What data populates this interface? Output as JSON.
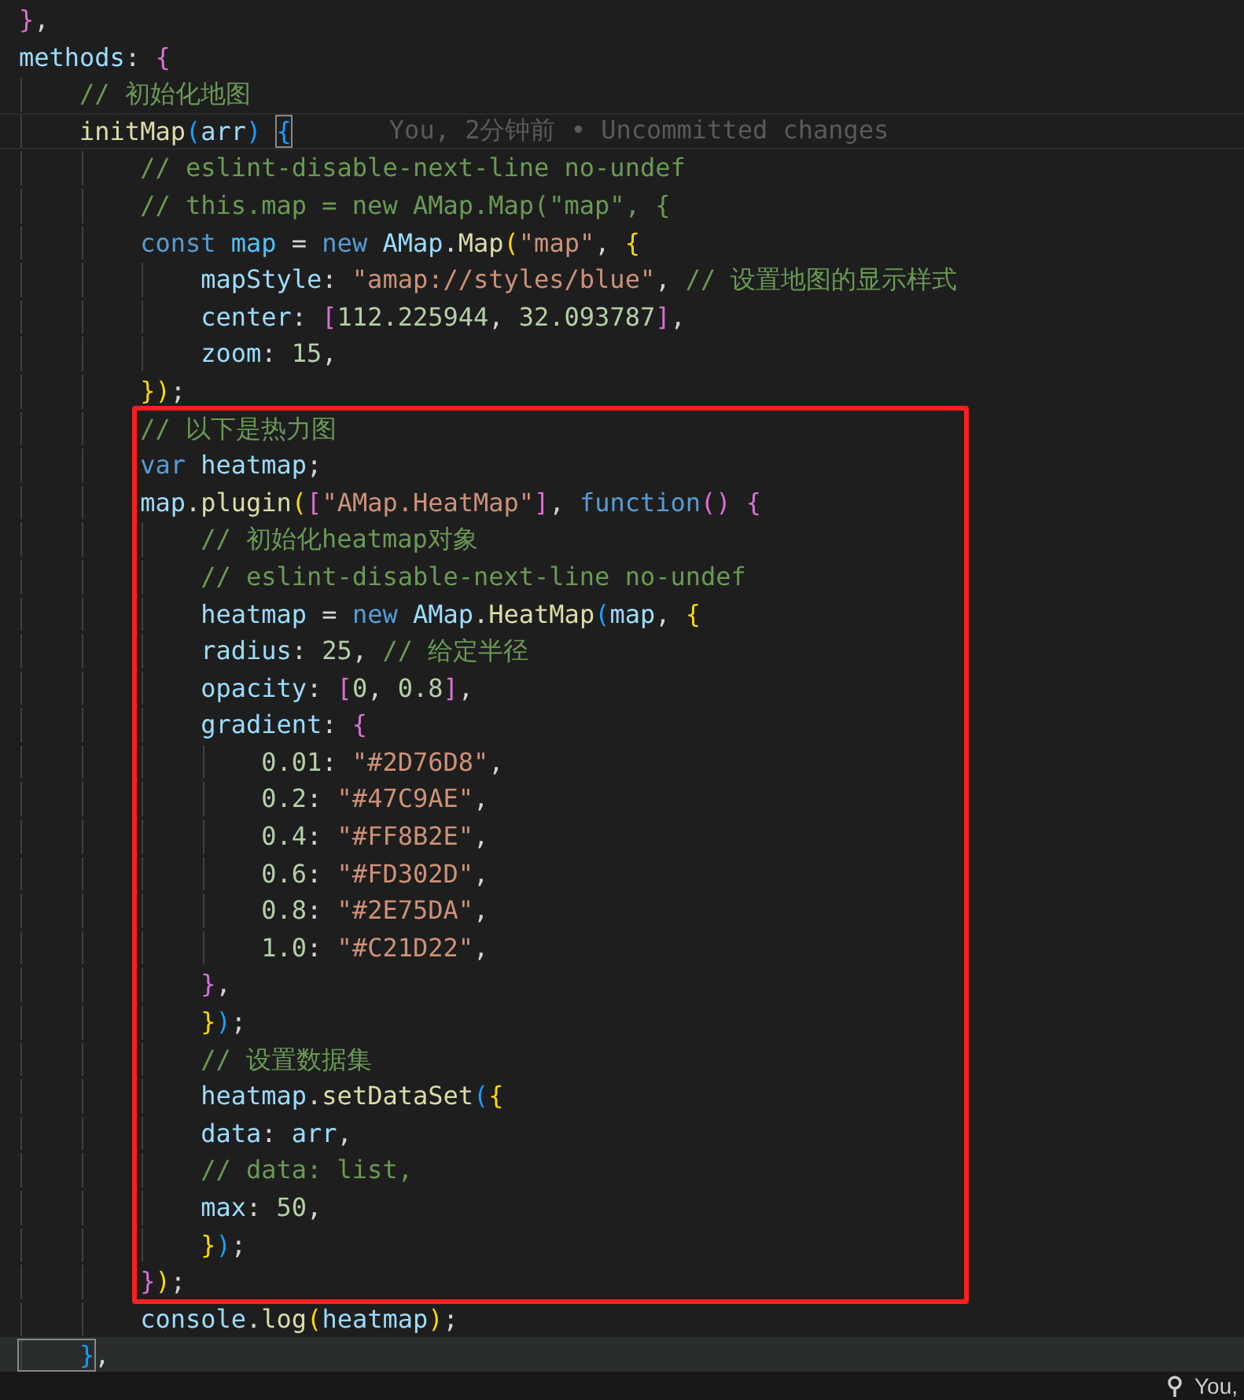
{
  "editor": {
    "lines_before": [
      {
        "tokens": [
          {
            "kind": "m",
            "text": "}"
          },
          {
            "kind": "p",
            "text": ","
          }
        ]
      },
      {
        "tokens": [
          {
            "kind": "v",
            "text": "methods"
          },
          {
            "kind": "p",
            "text": ": "
          },
          {
            "kind": "m",
            "text": "{"
          }
        ]
      },
      {
        "tokens": [
          {
            "kind": "c",
            "text": "    // 初始化地图"
          }
        ]
      },
      {
        "current": true,
        "tokens": [
          {
            "kind": "f",
            "text": "    initMap"
          },
          {
            "kind": "b",
            "text": "("
          },
          {
            "kind": "v",
            "text": "arr"
          },
          {
            "kind": "b",
            "text": ") "
          },
          {
            "kind": "b",
            "text": "{",
            "matched": true
          }
        ],
        "blame": "You, 2分钟前 • Uncommitted changes"
      },
      {
        "tokens": [
          {
            "kind": "c",
            "text": "        // eslint-disable-next-line no-undef"
          }
        ]
      },
      {
        "tokens": [
          {
            "kind": "c",
            "text": "        // this.map = new AMap.Map(\"map\", {"
          }
        ]
      },
      {
        "tokens": [
          {
            "kind": "k",
            "text": "        const "
          },
          {
            "kind": "x",
            "text": "map"
          },
          {
            "kind": "p",
            "text": " = "
          },
          {
            "kind": "k",
            "text": "new "
          },
          {
            "kind": "v",
            "text": "AMap"
          },
          {
            "kind": "p",
            "text": "."
          },
          {
            "kind": "f",
            "text": "Map"
          },
          {
            "kind": "g",
            "text": "("
          },
          {
            "kind": "s",
            "text": "\"map\""
          },
          {
            "kind": "p",
            "text": ", "
          },
          {
            "kind": "g",
            "text": "{"
          }
        ]
      },
      {
        "tokens": [
          {
            "kind": "v",
            "text": "            mapStyle"
          },
          {
            "kind": "p",
            "text": ": "
          },
          {
            "kind": "s",
            "text": "\"amap://styles/blue\""
          },
          {
            "kind": "p",
            "text": ", "
          },
          {
            "kind": "c",
            "text": "// 设置地图的显示样式"
          }
        ]
      },
      {
        "tokens": [
          {
            "kind": "v",
            "text": "            center"
          },
          {
            "kind": "p",
            "text": ": "
          },
          {
            "kind": "m",
            "text": "["
          },
          {
            "kind": "n",
            "text": "112.225944"
          },
          {
            "kind": "p",
            "text": ", "
          },
          {
            "kind": "n",
            "text": "32.093787"
          },
          {
            "kind": "m",
            "text": "]"
          },
          {
            "kind": "p",
            "text": ","
          }
        ]
      },
      {
        "tokens": [
          {
            "kind": "v",
            "text": "            zoom"
          },
          {
            "kind": "p",
            "text": ": "
          },
          {
            "kind": "n",
            "text": "15"
          },
          {
            "kind": "p",
            "text": ","
          }
        ]
      },
      {
        "tokens": [
          {
            "kind": "g",
            "text": "        })"
          },
          {
            "kind": "p",
            "text": ";"
          }
        ]
      }
    ],
    "framed_lines": [
      {
        "tokens": [
          {
            "kind": "c",
            "text": "        // 以下是热力图"
          }
        ]
      },
      {
        "tokens": [
          {
            "kind": "k",
            "text": "        var "
          },
          {
            "kind": "v",
            "text": "heatmap"
          },
          {
            "kind": "p",
            "text": ";"
          }
        ]
      },
      {
        "tokens": [
          {
            "kind": "v",
            "text": "        map"
          },
          {
            "kind": "p",
            "text": "."
          },
          {
            "kind": "f",
            "text": "plugin"
          },
          {
            "kind": "g",
            "text": "("
          },
          {
            "kind": "m",
            "text": "["
          },
          {
            "kind": "s",
            "text": "\"AMap.HeatMap\""
          },
          {
            "kind": "m",
            "text": "]"
          },
          {
            "kind": "p",
            "text": ", "
          },
          {
            "kind": "k",
            "text": "function"
          },
          {
            "kind": "m",
            "text": "() {"
          }
        ]
      },
      {
        "tokens": [
          {
            "kind": "c",
            "text": "            // 初始化heatmap对象"
          }
        ]
      },
      {
        "tokens": [
          {
            "kind": "c",
            "text": "            // eslint-disable-next-line no-undef"
          }
        ]
      },
      {
        "tokens": [
          {
            "kind": "v",
            "text": "            heatmap"
          },
          {
            "kind": "p",
            "text": " = "
          },
          {
            "kind": "k",
            "text": "new "
          },
          {
            "kind": "v",
            "text": "AMap"
          },
          {
            "kind": "p",
            "text": "."
          },
          {
            "kind": "f",
            "text": "HeatMap"
          },
          {
            "kind": "b",
            "text": "("
          },
          {
            "kind": "v",
            "text": "map"
          },
          {
            "kind": "p",
            "text": ", "
          },
          {
            "kind": "g",
            "text": "{"
          }
        ]
      },
      {
        "tokens": [
          {
            "kind": "v",
            "text": "            radius"
          },
          {
            "kind": "p",
            "text": ": "
          },
          {
            "kind": "n",
            "text": "25"
          },
          {
            "kind": "p",
            "text": ", "
          },
          {
            "kind": "c",
            "text": "// 给定半径"
          }
        ]
      },
      {
        "tokens": [
          {
            "kind": "v",
            "text": "            opacity"
          },
          {
            "kind": "p",
            "text": ": "
          },
          {
            "kind": "m",
            "text": "["
          },
          {
            "kind": "n",
            "text": "0"
          },
          {
            "kind": "p",
            "text": ", "
          },
          {
            "kind": "n",
            "text": "0.8"
          },
          {
            "kind": "m",
            "text": "]"
          },
          {
            "kind": "p",
            "text": ","
          }
        ]
      },
      {
        "tokens": [
          {
            "kind": "v",
            "text": "            gradient"
          },
          {
            "kind": "p",
            "text": ": "
          },
          {
            "kind": "m",
            "text": "{"
          }
        ]
      },
      {
        "tokens": [
          {
            "kind": "n",
            "text": "                0.01"
          },
          {
            "kind": "p",
            "text": ": "
          },
          {
            "kind": "s",
            "text": "\"#2D76D8\""
          },
          {
            "kind": "p",
            "text": ","
          }
        ]
      },
      {
        "tokens": [
          {
            "kind": "n",
            "text": "                0.2"
          },
          {
            "kind": "p",
            "text": ": "
          },
          {
            "kind": "s",
            "text": "\"#47C9AE\""
          },
          {
            "kind": "p",
            "text": ","
          }
        ]
      },
      {
        "tokens": [
          {
            "kind": "n",
            "text": "                0.4"
          },
          {
            "kind": "p",
            "text": ": "
          },
          {
            "kind": "s",
            "text": "\"#FF8B2E\""
          },
          {
            "kind": "p",
            "text": ","
          }
        ]
      },
      {
        "tokens": [
          {
            "kind": "n",
            "text": "                0.6"
          },
          {
            "kind": "p",
            "text": ": "
          },
          {
            "kind": "s",
            "text": "\"#FD302D\""
          },
          {
            "kind": "p",
            "text": ","
          }
        ]
      },
      {
        "tokens": [
          {
            "kind": "n",
            "text": "                0.8"
          },
          {
            "kind": "p",
            "text": ": "
          },
          {
            "kind": "s",
            "text": "\"#2E75DA\""
          },
          {
            "kind": "p",
            "text": ","
          }
        ]
      },
      {
        "tokens": [
          {
            "kind": "n",
            "text": "                1.0"
          },
          {
            "kind": "p",
            "text": ": "
          },
          {
            "kind": "s",
            "text": "\"#C21D22\""
          },
          {
            "kind": "p",
            "text": ","
          }
        ]
      },
      {
        "tokens": [
          {
            "kind": "m",
            "text": "            }"
          },
          {
            "kind": "p",
            "text": ","
          }
        ]
      },
      {
        "tokens": [
          {
            "kind": "g",
            "text": "            }"
          },
          {
            "kind": "b",
            "text": ")"
          },
          {
            "kind": "p",
            "text": ";"
          }
        ]
      },
      {
        "tokens": [
          {
            "kind": "c",
            "text": "            // 设置数据集"
          }
        ]
      },
      {
        "tokens": [
          {
            "kind": "v",
            "text": "            heatmap"
          },
          {
            "kind": "p",
            "text": "."
          },
          {
            "kind": "f",
            "text": "setDataSet"
          },
          {
            "kind": "b",
            "text": "("
          },
          {
            "kind": "g",
            "text": "{"
          }
        ]
      },
      {
        "tokens": [
          {
            "kind": "v",
            "text": "            data"
          },
          {
            "kind": "p",
            "text": ": "
          },
          {
            "kind": "v",
            "text": "arr"
          },
          {
            "kind": "p",
            "text": ","
          }
        ]
      },
      {
        "tokens": [
          {
            "kind": "c",
            "text": "            // data: list,"
          }
        ]
      },
      {
        "tokens": [
          {
            "kind": "v",
            "text": "            max"
          },
          {
            "kind": "p",
            "text": ": "
          },
          {
            "kind": "n",
            "text": "50"
          },
          {
            "kind": "p",
            "text": ","
          }
        ]
      },
      {
        "tokens": [
          {
            "kind": "g",
            "text": "            }"
          },
          {
            "kind": "b",
            "text": ")"
          },
          {
            "kind": "p",
            "text": ";"
          }
        ]
      },
      {
        "tokens": [
          {
            "kind": "m",
            "text": "        }"
          },
          {
            "kind": "g",
            "text": ")"
          },
          {
            "kind": "p",
            "text": ";"
          }
        ]
      }
    ],
    "lines_after": [
      {
        "tokens": [
          {
            "kind": "v",
            "text": "        console"
          },
          {
            "kind": "p",
            "text": "."
          },
          {
            "kind": "f",
            "text": "log"
          },
          {
            "kind": "g",
            "text": "("
          },
          {
            "kind": "v",
            "text": "heatmap"
          },
          {
            "kind": "g",
            "text": ")"
          },
          {
            "kind": "p",
            "text": ";"
          }
        ]
      },
      {
        "hovered": true,
        "tokens": [
          {
            "kind": "b",
            "text": "    }",
            "matched": true
          },
          {
            "kind": "p",
            "text": ","
          }
        ]
      }
    ]
  },
  "status_bar": {
    "text": "You,"
  }
}
